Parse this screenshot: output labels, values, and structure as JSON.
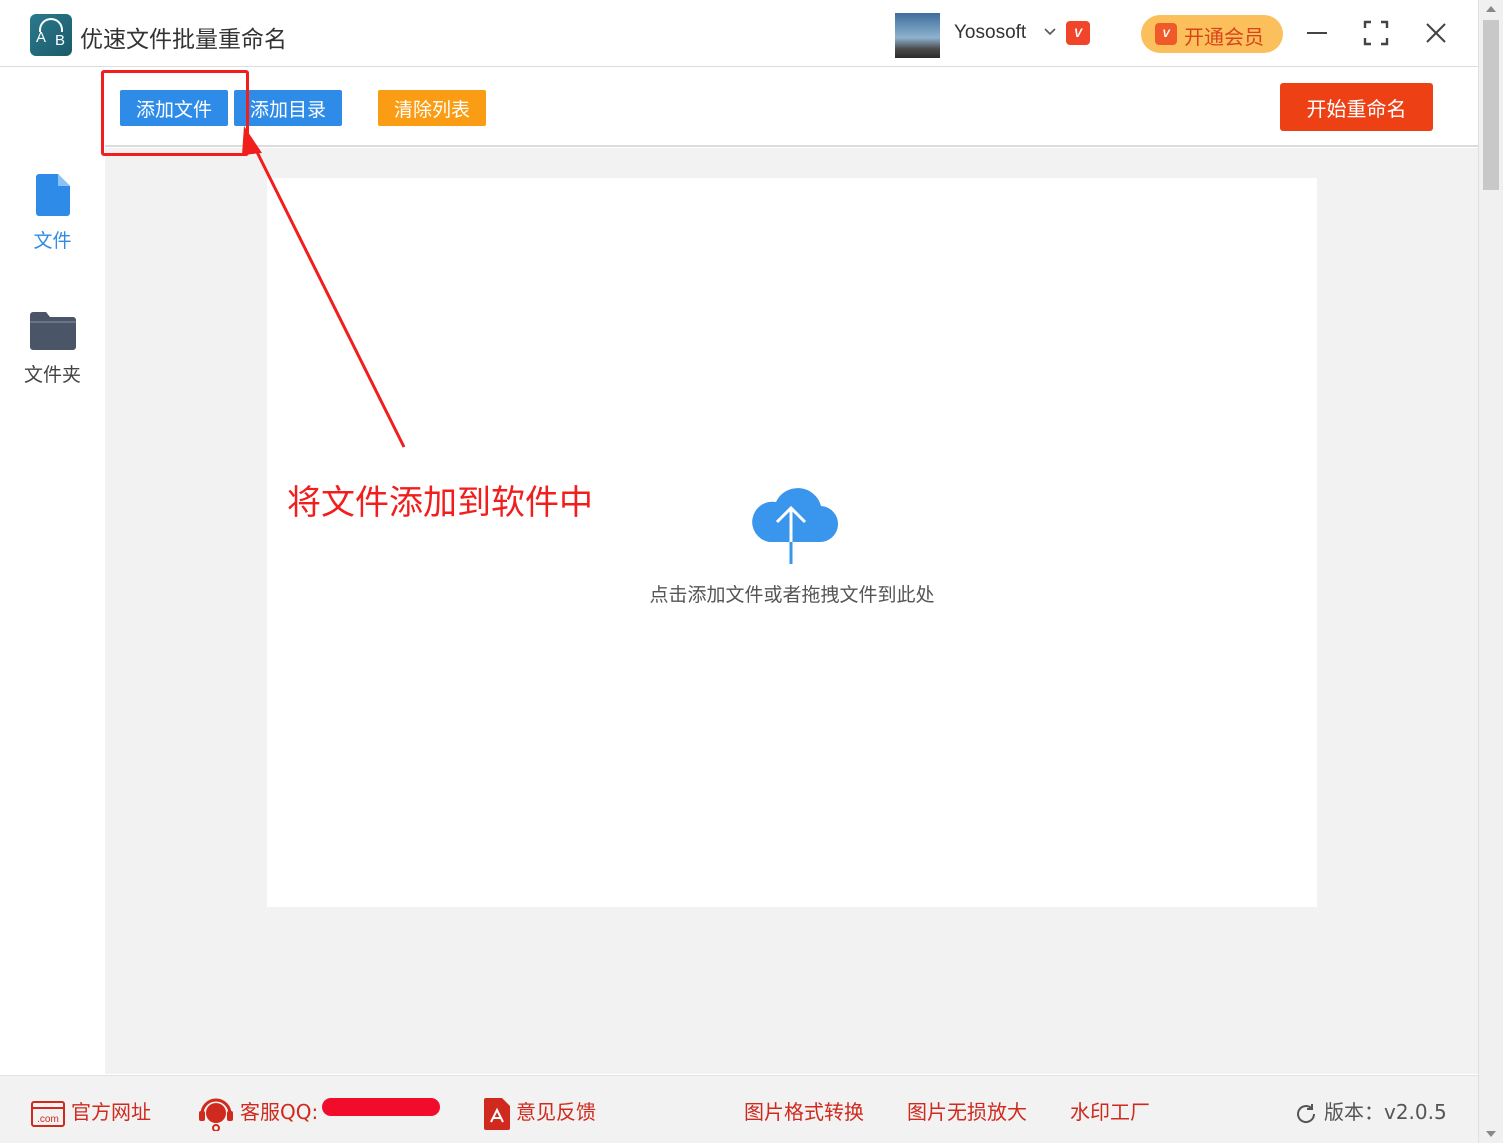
{
  "window": {
    "app_title": "优速文件批量重命名",
    "username": "Yososoft",
    "vip_badge": "VIP",
    "member_button": "开通会员"
  },
  "toolbar": {
    "add_file": "添加文件",
    "add_dir": "添加目录",
    "clear_list": "清除列表",
    "start_rename": "开始重命名"
  },
  "sidebar": {
    "items": [
      {
        "label": "文件",
        "icon": "file-icon",
        "active": true
      },
      {
        "label": "文件夹",
        "icon": "folder-icon",
        "active": false
      }
    ]
  },
  "dropzone": {
    "hint": "点击添加文件或者拖拽文件到此处",
    "icon": "cloud-upload-icon"
  },
  "annotation": {
    "text": "将文件添加到软件中"
  },
  "footer": {
    "website": "官方网址",
    "service": "客服QQ:",
    "feedback": "意见反馈",
    "img_convert": "图片格式转换",
    "img_enlarge": "图片无损放大",
    "watermark": "水印工厂",
    "version": "版本：v2.0.5"
  },
  "colors": {
    "accent_blue": "#2e8ce8",
    "accent_orange": "#fa9d14",
    "accent_red": "#ed4015",
    "annotation_red": "#f11e1e",
    "footer_red": "#d02a1e",
    "icon_dark": "#4a5568"
  }
}
